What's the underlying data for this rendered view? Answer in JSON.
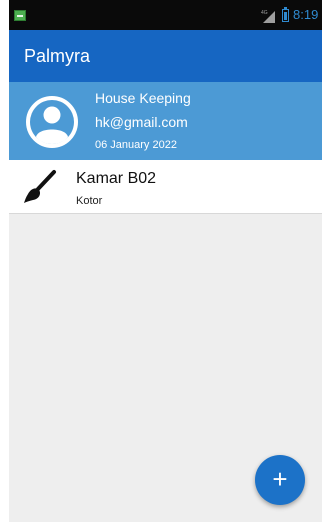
{
  "status_bar": {
    "network_label": "4G",
    "time": "8:19"
  },
  "app_bar": {
    "title": "Palmyra"
  },
  "profile": {
    "role": "House Keeping",
    "email": "hk@gmail.com",
    "date": "06 January 2022",
    "avatar_icon": "account-circle-icon"
  },
  "rooms": [
    {
      "name": "Kamar B02",
      "status": "Kotor",
      "icon": "brush-icon"
    }
  ],
  "fab": {
    "label": "+"
  },
  "colors": {
    "app_bar": "#1666c2",
    "profile_header": "#4c9ad5",
    "fab": "#1c72c8",
    "background": "#eeeeee"
  }
}
